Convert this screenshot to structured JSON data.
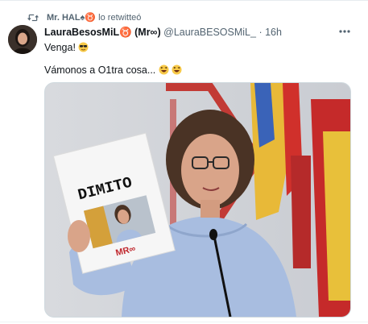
{
  "retweet": {
    "user": "Mr. HAL♠♉",
    "suffix": "lo retwitteó"
  },
  "tweet": {
    "display_name": "LauraBesosMiL♉ (Mr∞)",
    "handle": "@LauraBESOSMiL_",
    "time": "· 16h",
    "line1": "Venga!",
    "line2": "Vámonos a O1tra cosa..."
  },
  "media": {
    "sign_text": "DIMITO",
    "logo_text": "MR∞"
  },
  "icons": {
    "retweet": "retweet-icon",
    "more": "more-icon",
    "emoji": "sunglasses-emoji-icon",
    "laugh": "laughing-emoji-icon"
  }
}
